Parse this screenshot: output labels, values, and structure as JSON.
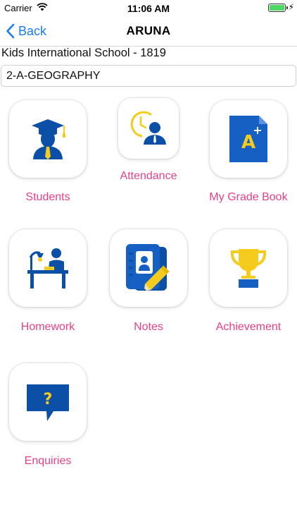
{
  "status_bar": {
    "carrier": "Carrier",
    "time": "11:06 AM",
    "battery_level": 1.0
  },
  "nav": {
    "back_label": "Back",
    "title": "ARUNA"
  },
  "school": {
    "name": "Kids International School  - 1819"
  },
  "class_selector": {
    "value": "2-A-GEOGRAPHY"
  },
  "menu": {
    "items": [
      {
        "label": "Students",
        "icon": "student-graduate-icon"
      },
      {
        "label": "Attendance",
        "icon": "attendance-clock-icon"
      },
      {
        "label": "My Grade Book",
        "icon": "grade-book-icon"
      },
      {
        "label": "Homework",
        "icon": "homework-desk-icon"
      },
      {
        "label": "Notes",
        "icon": "notes-pencil-icon"
      },
      {
        "label": "Achievement",
        "icon": "trophy-icon"
      },
      {
        "label": "Enquiries",
        "icon": "question-bubble-icon"
      }
    ]
  },
  "colors": {
    "label_pink": "#e5418a",
    "icon_blue": "#0b4fa6",
    "icon_yellow": "#f5cc1d",
    "link_blue": "#1a7cf5"
  }
}
